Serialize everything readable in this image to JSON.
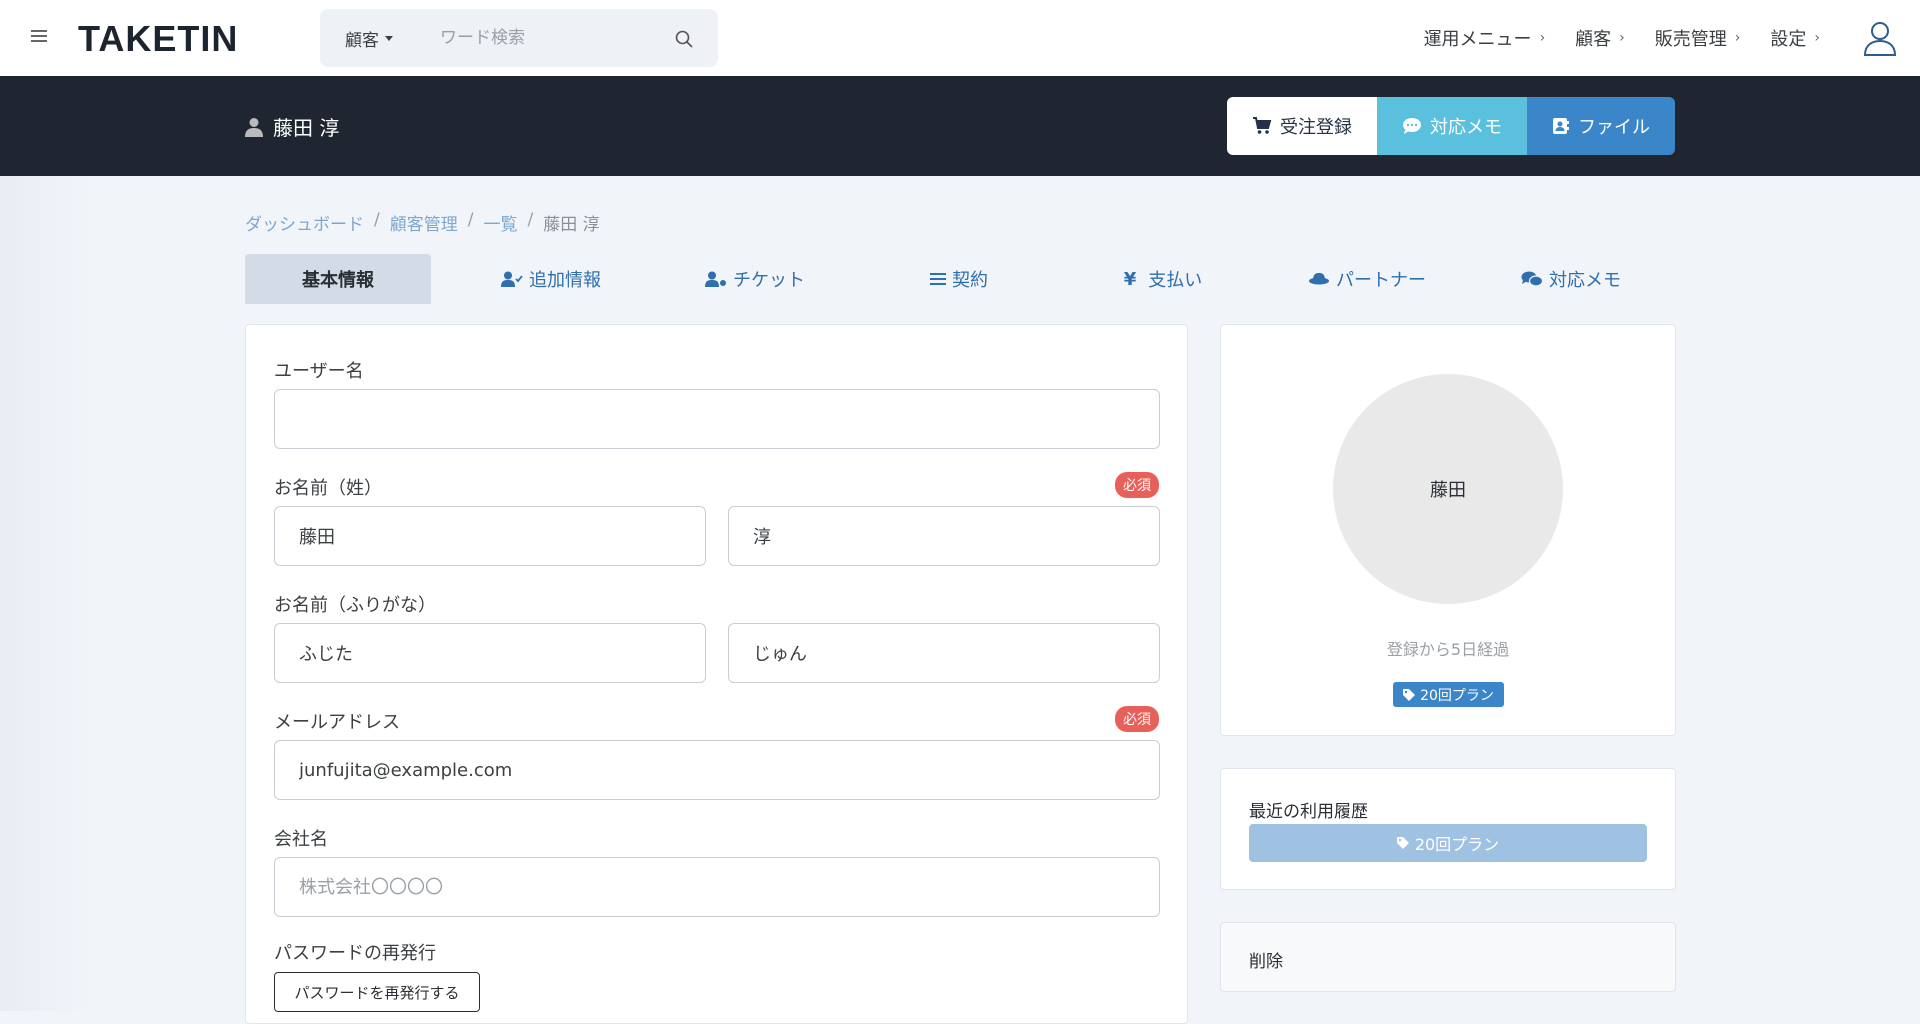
{
  "brand": {
    "logo": "TAKETIN"
  },
  "search": {
    "category": "顧客",
    "placeholder": "ワード検索"
  },
  "nav": {
    "items": [
      {
        "label": "運用メニュー"
      },
      {
        "label": "顧客"
      },
      {
        "label": "販売管理"
      },
      {
        "label": "設定"
      }
    ]
  },
  "header": {
    "customer_name": "藤田 淳",
    "buttons": {
      "order": "受注登録",
      "memo": "対応メモ",
      "file": "ファイル"
    }
  },
  "breadcrumb": [
    "ダッシュボード",
    "顧客管理",
    "一覧",
    "藤田 淳"
  ],
  "tabs": [
    "基本情報",
    "追加情報",
    "チケット",
    "契約",
    "支払い",
    "パートナー",
    "対応メモ"
  ],
  "form": {
    "username": {
      "label": "ユーザー名",
      "value": ""
    },
    "name": {
      "label": "お名前（姓）",
      "required": "必須",
      "last": "藤田",
      "first": "淳"
    },
    "kana": {
      "label": "お名前（ふりがな）",
      "last": "ふじた",
      "first": "じゅん"
    },
    "email": {
      "label": "メールアドレス",
      "required": "必須",
      "value": "junfujita@example.com"
    },
    "company": {
      "label": "会社名",
      "placeholder": "株式会社〇〇〇〇",
      "value": ""
    },
    "password": {
      "label": "パスワードの再発行",
      "button": "パスワードを再発行する"
    }
  },
  "profile": {
    "avatar_text": "藤田",
    "elapsed": "登録から5日経過",
    "plan": "20回プラン"
  },
  "history": {
    "title": "最近の利用履歴",
    "item": "20回プラン"
  },
  "delete": {
    "label": "削除"
  },
  "colors": {
    "accent": "#3a86c8",
    "memo": "#5bc0de",
    "header_bg": "#1f2631",
    "required": "#e8605a"
  }
}
